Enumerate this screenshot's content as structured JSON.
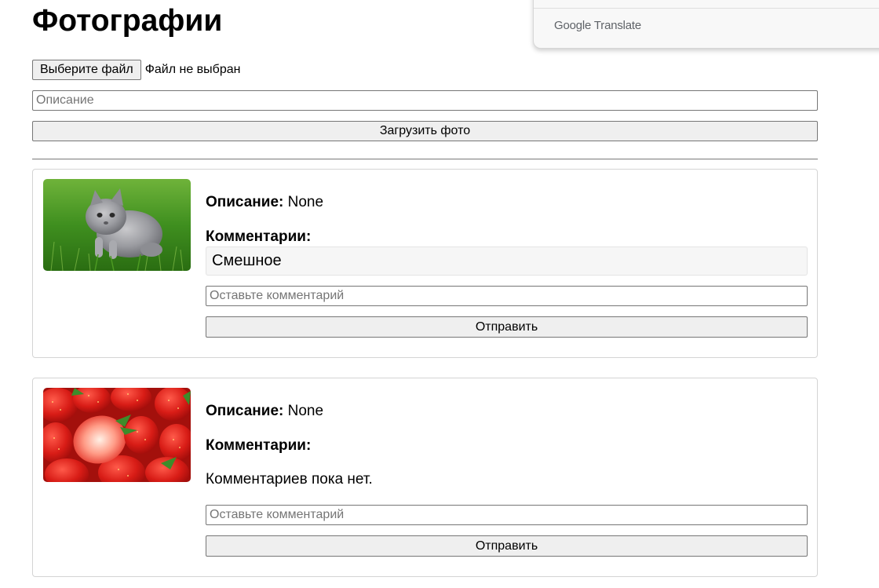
{
  "page": {
    "title": "Фотографии"
  },
  "translate_popup": {
    "brand": "Google Translate"
  },
  "upload_form": {
    "choose_file_label": "Выберите файл",
    "file_status": "Файл не выбран",
    "description_placeholder": "Описание",
    "description_value": "",
    "upload_button_label": "Загрузить фото"
  },
  "photos": [
    {
      "image_icon": "kitten-photo",
      "description_label": "Описание:",
      "description_value": "None",
      "comments_heading": "Комментарии:",
      "comments": [
        "Смешное"
      ],
      "comment_placeholder": "Оставьте комментарий",
      "comment_value": "",
      "send_button_label": "Отправить"
    },
    {
      "image_icon": "strawberries-photo",
      "description_label": "Описание:",
      "description_value": "None",
      "comments_heading": "Комментарии:",
      "no_comments_text": "Комментариев пока нет.",
      "comment_placeholder": "Оставьте комментарий",
      "comment_value": "",
      "send_button_label": "Отправить"
    }
  ]
}
